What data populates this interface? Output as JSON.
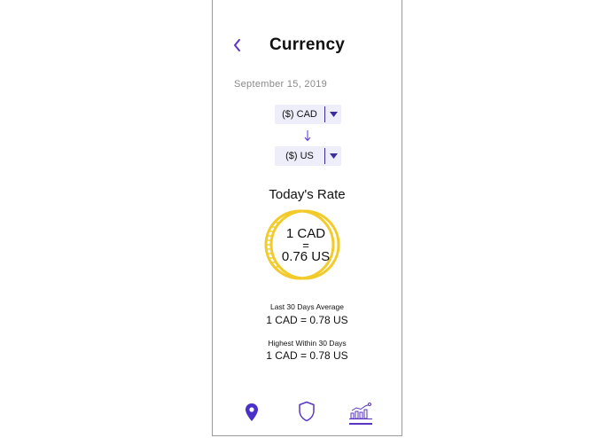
{
  "header": {
    "title": "Currency",
    "back_icon": "chevron-left-icon"
  },
  "date": "September 15, 2019",
  "converter": {
    "from_currency": "($) CAD",
    "to_currency": "($) US",
    "dropdown_icon": "caret-down-icon",
    "swap_icon": "arrow-down-icon"
  },
  "rate": {
    "title": "Today's Rate",
    "line1": "1 CAD",
    "line2": "=",
    "line3": "0.76 US",
    "coin_icon": "coin-icon"
  },
  "stats": [
    {
      "label": "Last 30 Days Average",
      "value": "1 CAD = 0.78 US"
    },
    {
      "label": "Highest Within 30 Days",
      "value": "1 CAD = 0.78 US"
    }
  ],
  "bottom_nav": [
    {
      "icon": "map-pin-icon",
      "active": false
    },
    {
      "icon": "shield-icon",
      "active": false
    },
    {
      "icon": "chart-icon",
      "active": true
    }
  ],
  "colors": {
    "accent": "#5a34c2",
    "coin": "#f2cb2a",
    "select_bg": "#eeeefa",
    "muted_text": "#8a8a8a"
  }
}
